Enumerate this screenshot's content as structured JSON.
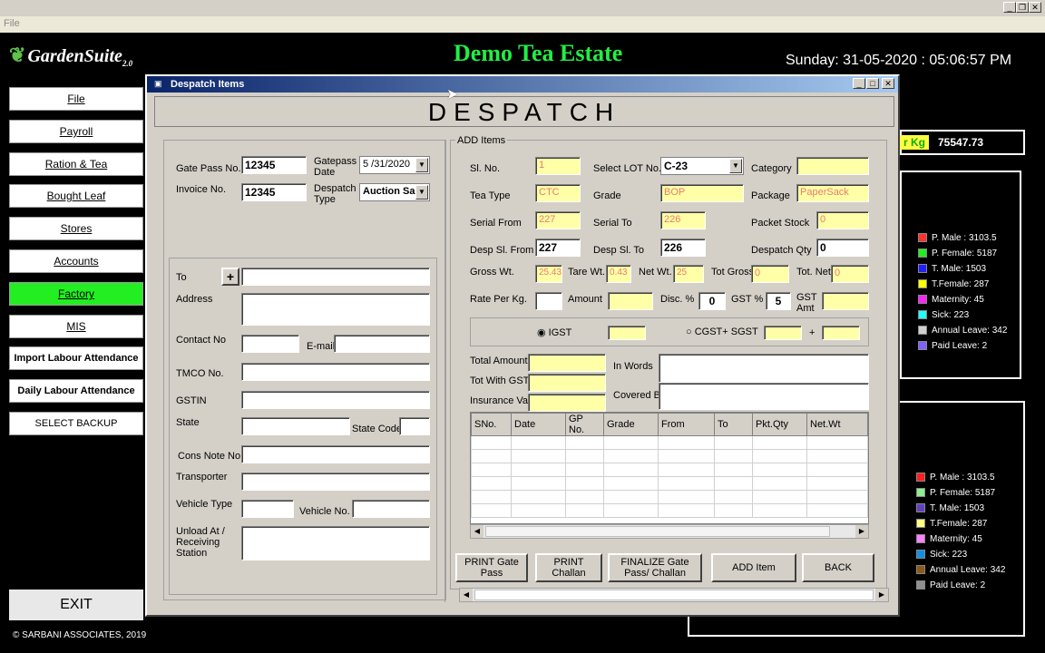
{
  "outer": {
    "menu_file": "File"
  },
  "header": {
    "logo": "GardenSuite",
    "logo_ver": "2.0",
    "estate": "Demo Tea Estate",
    "datetime": "Sunday: 31-05-2020 : 05:06:57 PM"
  },
  "nav": {
    "items": [
      "File",
      "Payroll",
      "Ration & Tea",
      "Bought Leaf",
      "Stores",
      "Accounts",
      "Factory",
      "MIS",
      "Import Labour Attendance",
      "Daily Labour Attendance",
      "SELECT BACKUP LOCATION"
    ],
    "exit": "EXIT",
    "copyright": "© SARBANI ASSOCIATES, 2019"
  },
  "right": {
    "kg_label": "r Kg",
    "kg_value": "75547.73",
    "legend1": [
      {
        "label": "P. Male : 3103.5",
        "color": "#ff3030"
      },
      {
        "label": "P. Female: 5187",
        "color": "#22ee22"
      },
      {
        "label": "T. Male: 1503",
        "color": "#2020ff"
      },
      {
        "label": "T.Female: 287",
        "color": "#ffff00"
      },
      {
        "label": "Maternity: 45",
        "color": "#ff22ff"
      },
      {
        "label": "Sick: 223",
        "color": "#22ffff"
      },
      {
        "label": "Annual Leave: 342",
        "color": "#d0d0d0"
      },
      {
        "label": "Paid Leave: 2",
        "color": "#8060ff"
      }
    ],
    "legend2": [
      {
        "label": "P. Male : 3103.5",
        "color": "#ff2020"
      },
      {
        "label": "P. Female: 5187",
        "color": "#90ee90"
      },
      {
        "label": "T. Male: 1503",
        "color": "#6040c0"
      },
      {
        "label": "T.Female: 287",
        "color": "#ffff80"
      },
      {
        "label": "Maternity: 45",
        "color": "#ff80ff"
      },
      {
        "label": "Sick: 223",
        "color": "#1090e0"
      },
      {
        "label": "Annual Leave: 342",
        "color": "#8b5a1a"
      },
      {
        "label": "Paid Leave: 2",
        "color": "#909090"
      }
    ]
  },
  "dialog": {
    "title": "Despatch Items",
    "heading": "DESPATCH",
    "left": {
      "gate_pass_no_label": "Gate Pass No.",
      "gate_pass_no": "12345",
      "gatepass_date_label": "Gatepass Date",
      "gatepass_date": "5 /31/2020",
      "invoice_no_label": "Invoice No.",
      "invoice_no": "12345",
      "despatch_type_label": "Despatch Type",
      "despatch_type": "Auction Sale",
      "to_label": "To",
      "add_symbol": "+",
      "address_label": "Address",
      "contact_label": "Contact No",
      "email_label": "E-mail",
      "tmco_label": "TMCO No.",
      "gstin_label": "GSTIN",
      "state_label": "State",
      "state_code_label": "State Code",
      "cons_note_label": "Cons Note  No",
      "transporter_label": "Transporter",
      "vehicle_type_label": "Vehicle Type",
      "vehicle_no_label": "Vehicle No.",
      "unload_label": "Unload At / Receiving Station"
    },
    "add_items": {
      "legend": "ADD Items",
      "sl_no_label": "Sl. No.",
      "sl_no": "1",
      "select_lot_label": "Select LOT No.",
      "select_lot": "C-23",
      "category_label": "Category",
      "tea_type_label": "Tea Type",
      "tea_type": "CTC",
      "grade_label": "Grade",
      "grade": "BOP",
      "package_label": "Package",
      "package": "PaperSack",
      "serial_from_label": "Serial From",
      "serial_from": "227",
      "serial_to_label": "Serial To",
      "serial_to": "226",
      "packet_stock_label": "Packet Stock",
      "packet_stock": "0",
      "desp_from_label": "Desp Sl. From",
      "desp_from": "227",
      "desp_to_label": "Desp Sl. To",
      "desp_to": "226",
      "desp_qty_label": "Despatch Qty",
      "desp_qty": "0",
      "gross_label": "Gross Wt.",
      "gross": "25.43",
      "tare_label": "Tare Wt.",
      "tare": "0.43",
      "net_label": "Net Wt.",
      "net": "25",
      "tot_gross_label": "Tot Gross",
      "tot_gross": "0",
      "tot_net_label": "Tot. Net",
      "tot_net": "0",
      "rate_label": "Rate Per Kg.",
      "amount_label": "Amount",
      "disc_label": "Disc. %",
      "disc": "0",
      "gst_label": "GST %",
      "gst": "5",
      "gst_amt_label": "GST Amt",
      "igst_label": "IGST",
      "cgst_label": "CGST+ SGST",
      "plus": "+",
      "total_amount_label": "Total Amount",
      "tot_with_gst_label": "Tot With GST",
      "insurance_label": "Insurance Val",
      "in_words_label": "In Words",
      "covered_by_label": "Covered By",
      "columns": [
        "SNo.",
        "Date",
        "GP No.",
        "Grade",
        "From",
        "To",
        "Pkt.Qty",
        "Net.Wt"
      ]
    },
    "buttons": {
      "print_gate": "PRINT Gate Pass",
      "print_challan": "PRINT Challan",
      "finalize": "FINALIZE Gate Pass/ Challan",
      "add_item": "ADD Item",
      "back": "BACK"
    }
  }
}
